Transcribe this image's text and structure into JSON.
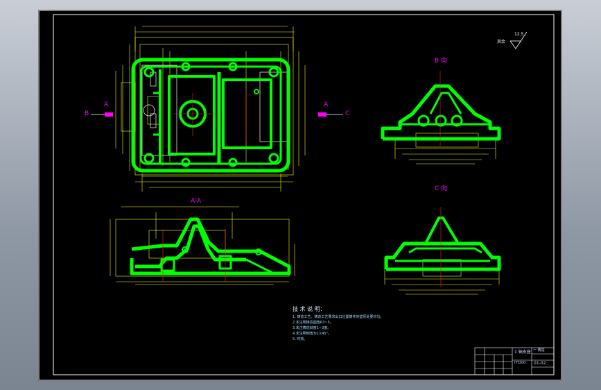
{
  "colors": {
    "background": "#000000",
    "outline": "#ffffff",
    "casting": "#00ff00",
    "dimension": "#ffff00",
    "section_marker": "#ff00ff",
    "centerline": "#ff2020",
    "notes": "#9fdcff"
  },
  "views": {
    "section_left": "B",
    "section_right": "C",
    "section_letter": "A",
    "section_view_title": "A-A",
    "b_view_title": "B 向",
    "c_view_title": "C 向"
  },
  "surface_finish": {
    "prefix": "其余",
    "value": "12.5"
  },
  "notes": {
    "title": "技 术 说 明：",
    "items": [
      "1. 铸造工艺。铸造工艺要求出口位置铸件的壁厚处要均匀。",
      "2.本注明铸造圆角R3~5。",
      "3.未注铸造斜度1~3度。",
      "4.未注明倒角为1×45°。",
      "5. 时效。"
    ]
  },
  "title_block": {
    "part_name": "1 轴支座",
    "material": "HT200",
    "title_top": "一 铸造",
    "sheet_code": "01-02"
  }
}
